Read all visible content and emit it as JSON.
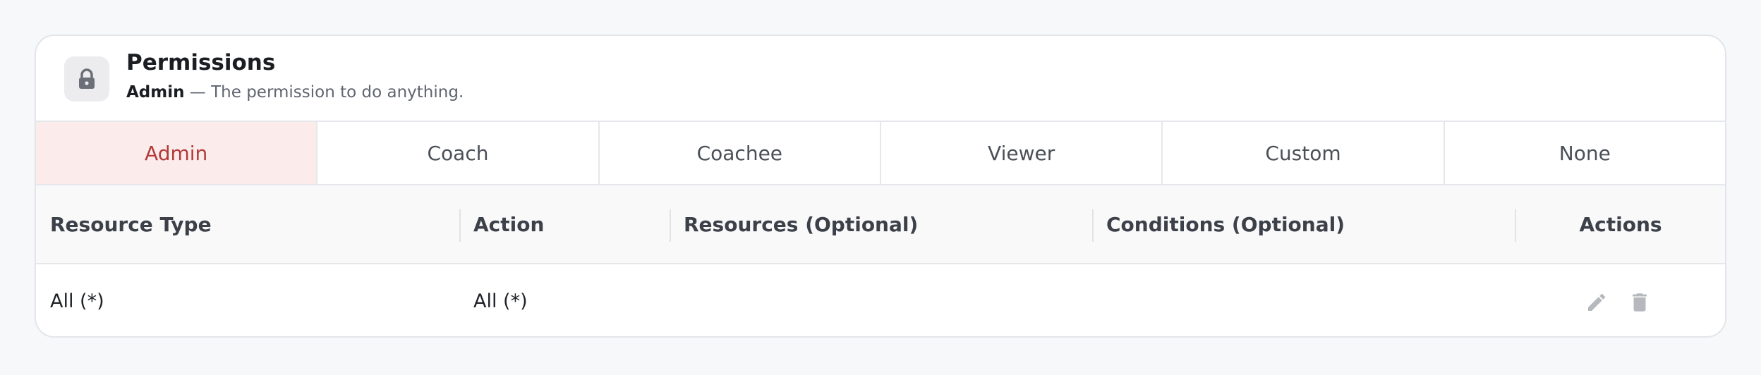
{
  "card": {
    "title": "Permissions",
    "role": "Admin",
    "description": " — The permission to do anything.",
    "lock_icon": "lock-icon"
  },
  "tabs": [
    {
      "label": "Admin",
      "active": true
    },
    {
      "label": "Coach",
      "active": false
    },
    {
      "label": "Coachee",
      "active": false
    },
    {
      "label": "Viewer",
      "active": false
    },
    {
      "label": "Custom",
      "active": false
    },
    {
      "label": "None",
      "active": false
    }
  ],
  "table": {
    "headers": [
      "Resource Type",
      "Action",
      "Resources (Optional)",
      "Conditions (Optional)",
      "Actions"
    ],
    "rows": [
      {
        "resource_type": "All (*)",
        "action": "All (*)",
        "resources": "",
        "conditions": "",
        "actions": [
          "edit-icon",
          "trash-icon"
        ]
      }
    ]
  },
  "colors": {
    "accent": "#b23a3a",
    "active_tab_bg": "#fbeceb",
    "icon_gray": "#b5b8bd"
  }
}
